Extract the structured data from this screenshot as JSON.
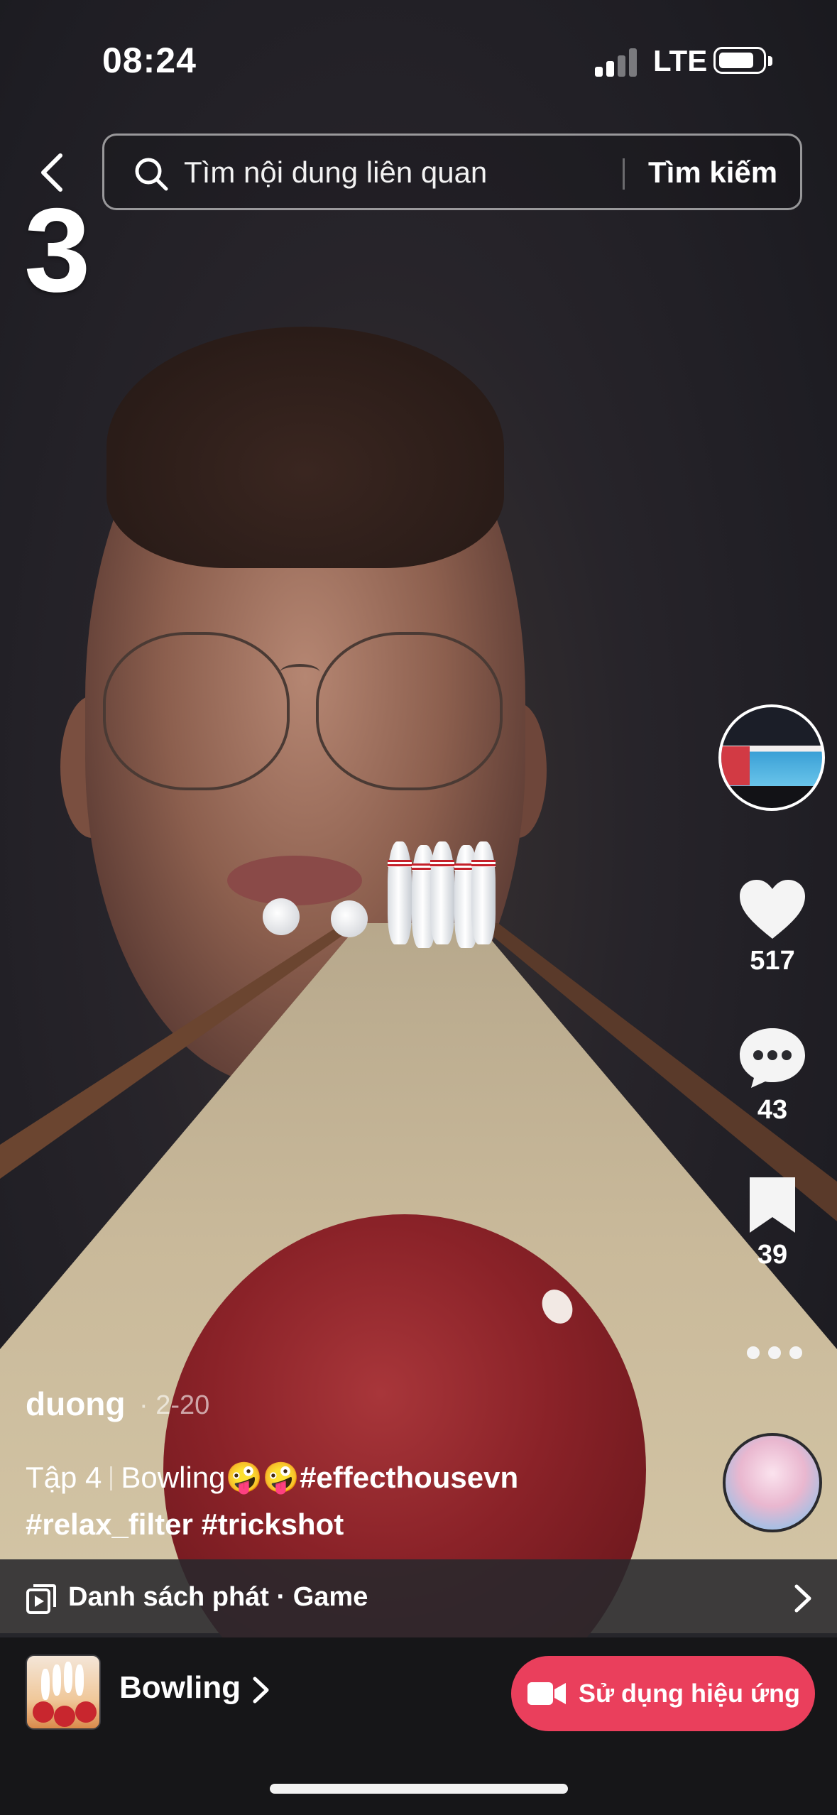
{
  "status_bar": {
    "time": "08:24",
    "network": "LTE",
    "icons": [
      "signal-icon",
      "battery-icon"
    ]
  },
  "search": {
    "placeholder": "Tìm nội dung liên quan",
    "button_label": "Tìm kiếm"
  },
  "overlay_counter": "3",
  "video": {
    "author": "duong",
    "date": "· 2-20",
    "caption_part": "Tập 4",
    "caption_title": "Bowling🤪🤪",
    "caption_tags": [
      "#effecthousevn",
      "#relax_filter",
      "#trickshot"
    ]
  },
  "actions": {
    "likes": "517",
    "comments": "43",
    "saves": "39"
  },
  "playlist": {
    "label": "Danh sách phát · Game"
  },
  "effect": {
    "name": "Bowling",
    "use_button_label": "Sử dụng hiệu ứng"
  },
  "colors": {
    "accent": "#ea3f5c",
    "bar_bg": "#161618"
  }
}
